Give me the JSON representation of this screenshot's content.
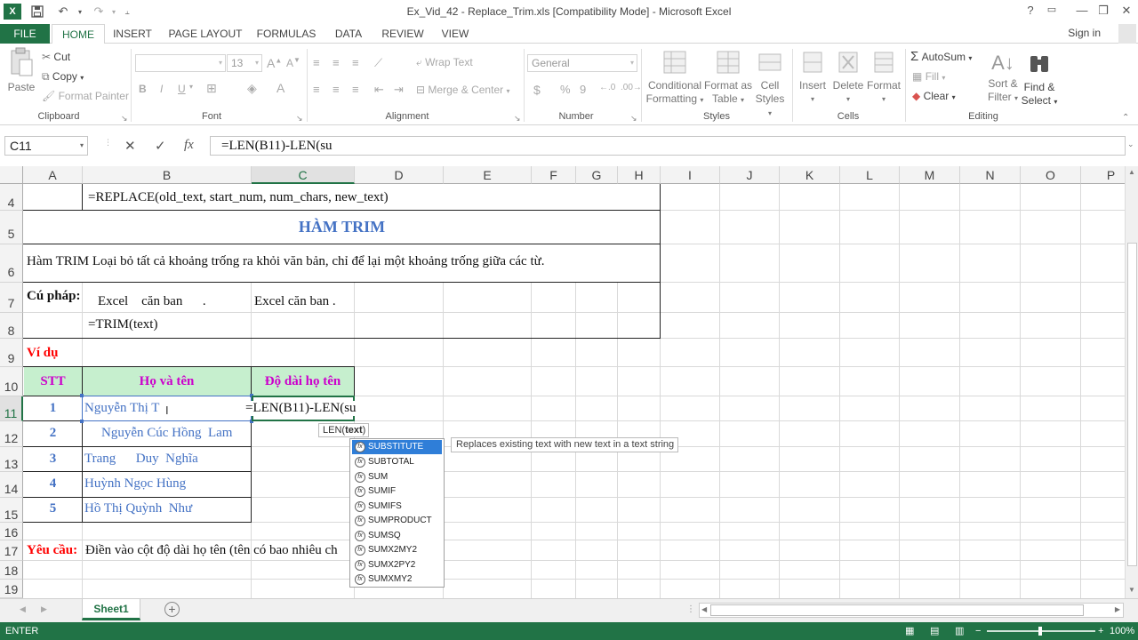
{
  "window": {
    "title": "Ex_Vid_42 - Replace_Trim.xls  [Compatibility Mode] - Microsoft Excel",
    "help": "?",
    "minimize": "—",
    "restore": "❒",
    "close": "✕"
  },
  "quick_access": {
    "save": "💾",
    "undo": "↶",
    "redo": "↷",
    "customize": "⫠"
  },
  "tabs": [
    "FILE",
    "HOME",
    "INSERT",
    "PAGE LAYOUT",
    "FORMULAS",
    "DATA",
    "REVIEW",
    "VIEW"
  ],
  "signin": "Sign in",
  "ribbon": {
    "clipboard": {
      "paste": "Paste",
      "cut": "Cut",
      "copy": "Copy",
      "format_painter": "Format Painter",
      "label": "Clipboard"
    },
    "font": {
      "size": "13",
      "bold": "B",
      "italic": "I",
      "underline": "U",
      "label": "Font"
    },
    "alignment": {
      "wrap_text": "Wrap Text",
      "merge_center": "Merge & Center",
      "label": "Alignment"
    },
    "number": {
      "format": "General",
      "currency": "$",
      "percent": "%",
      "comma": "9",
      "label": "Number"
    },
    "styles": {
      "conditional": "Conditional",
      "formatting": "Formatting",
      "format_as": "Format as",
      "table": "Table",
      "cell": "Cell",
      "styles": "Styles",
      "label": "Styles"
    },
    "cells": {
      "insert": "Insert",
      "delete": "Delete",
      "format": "Format",
      "label": "Cells"
    },
    "editing": {
      "autosum": "AutoSum",
      "fill": "Fill",
      "clear": "Clear",
      "sort": "Sort &",
      "filter": "Filter",
      "find": "Find &",
      "select": "Select",
      "label": "Editing"
    }
  },
  "formula_bar": {
    "name_box": "C11",
    "cancel": "✕",
    "enter": "✓",
    "fx": "fx",
    "formula": "=LEN(B11)-LEN(su"
  },
  "columns": [
    "A",
    "B",
    "C",
    "D",
    "E",
    "F",
    "G",
    "H",
    "I",
    "J",
    "K",
    "L",
    "M",
    "N",
    "O",
    "P"
  ],
  "rows": [
    "4",
    "5",
    "6",
    "7",
    "8",
    "9",
    "10",
    "11",
    "12",
    "13",
    "14",
    "15",
    "16",
    "17",
    "18",
    "19"
  ],
  "cells": {
    "r4_formula": "=REPLACE(old_text, start_num, num_chars, new_text)",
    "r5_title": "HÀM TRIM",
    "r6_desc": "Hàm TRIM Loại bỏ tất cả khoảng trống ra khỏi văn bản, chỉ để lại một khoảng trống giữa các từ.",
    "r7_label": "Cú pháp:",
    "r7_b": "Excel    căn ban      .",
    "r7_c": "Excel căn ban .",
    "r8_formula": "=TRIM(text)",
    "r9_label": "Ví dụ",
    "h_stt": "STT",
    "h_name": "Họ và tên",
    "h_len": "Độ dài họ tên",
    "data_rows": [
      {
        "stt": "1",
        "name": "Nguyễn Thị T"
      },
      {
        "stt": "2",
        "name": "Nguyễn Cúc Hồng  Lam"
      },
      {
        "stt": "3",
        "name": "Trang      Duy  Nghĩa"
      },
      {
        "stt": "4",
        "name": "Huỳnh Ngọc Hùng"
      },
      {
        "stt": "5",
        "name": "Hồ Thị Quỳnh  Như"
      }
    ],
    "c11_edit": "=LEN(B11)-LEN(su",
    "r17_label": "Yêu cầu:",
    "r17_text": "Điền vào cột độ dài họ tên (tên có bao nhiêu ch"
  },
  "autocomplete": {
    "hint_prefix": "LEN(",
    "hint_arg": "text",
    "hint_suffix": ")",
    "items": [
      "SUBSTITUTE",
      "SUBTOTAL",
      "SUM",
      "SUMIF",
      "SUMIFS",
      "SUMPRODUCT",
      "SUMSQ",
      "SUMX2MY2",
      "SUMX2PY2",
      "SUMXMY2"
    ],
    "tooltip": "Replaces existing text with new text in a text string"
  },
  "sheet_tabs": {
    "active": "Sheet1",
    "add": "+"
  },
  "status": {
    "mode": "ENTER",
    "zoom": "100%"
  },
  "colors": {
    "excel_green": "#217346",
    "header_fill": "#c6efce",
    "blue_text": "#4472c4",
    "magenta_text": "#cc00cc",
    "red_text": "#ff0000",
    "title_blue": "#4472c4"
  }
}
